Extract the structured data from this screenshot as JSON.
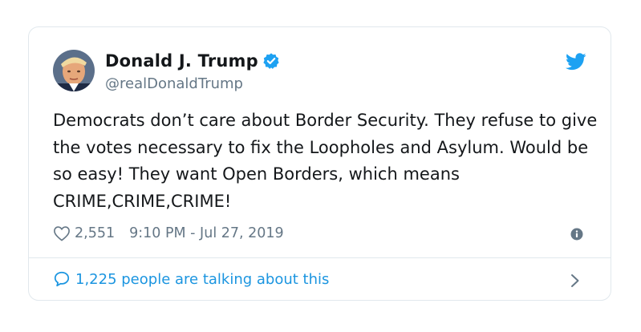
{
  "author": {
    "name": "Donald J. Trump",
    "handle": "@realDonaldTrump",
    "verified": true
  },
  "tweet": {
    "text": "Democrats don’t care about Border Security. They refuse to give the votes necessary to fix the Loopholes and Asylum. Would be so easy! They want Open Borders, which means CRIME,CRIME,CRIME!",
    "likes": "2,551",
    "timestamp": "9:10 PM - Jul 27, 2019"
  },
  "footer": {
    "talking_label": "1,225 people are talking about this"
  },
  "icons": {
    "brand": "twitter-bird-icon",
    "verified": "verified-badge-icon",
    "like": "heart-icon",
    "info": "info-icon",
    "conversation": "speech-bubble-icon",
    "chevron": "chevron-right-icon"
  },
  "colors": {
    "accent": "#1da1f2",
    "link": "#1b95e0",
    "muted": "#657786",
    "border": "#e1e8ed"
  }
}
